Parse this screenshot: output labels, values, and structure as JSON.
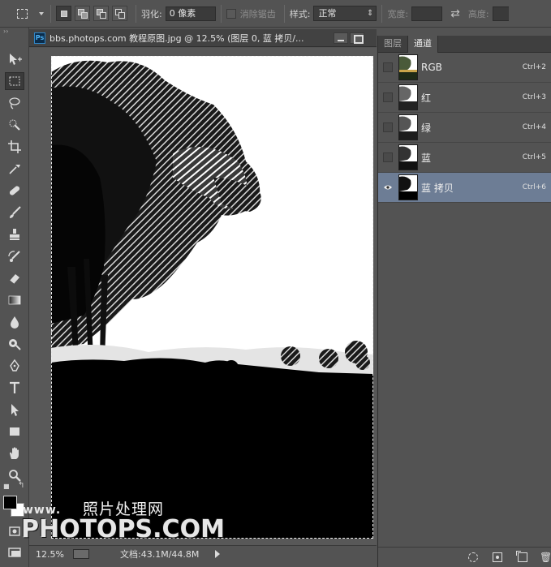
{
  "options_bar": {
    "feather_label": "羽化:",
    "feather_value": "0 像素",
    "antialias_label": "消除锯齿",
    "style_label": "样式:",
    "style_value": "正常",
    "width_label": "宽度:",
    "height_label": "高度:"
  },
  "document": {
    "title": "bbs.photops.com 教程原图.jpg @ 12.5% (图层 0, 蓝 拷贝/...",
    "ps_badge": "Ps",
    "zoom": "12.5%",
    "doc_size": "文档:43.1M/44.8M"
  },
  "watermark": {
    "www": "www.",
    "site_cn": "照片处理网",
    "site": "PHOTOPS.COM"
  },
  "panel": {
    "tabs": [
      {
        "label": "图层",
        "active": false
      },
      {
        "label": "通道",
        "active": true
      }
    ],
    "channels": [
      {
        "name": "RGB",
        "shortcut": "Ctrl+2",
        "visible": false,
        "selected": false
      },
      {
        "name": "红",
        "shortcut": "Ctrl+3",
        "visible": false,
        "selected": false
      },
      {
        "name": "绿",
        "shortcut": "Ctrl+4",
        "visible": false,
        "selected": false
      },
      {
        "name": "蓝",
        "shortcut": "Ctrl+5",
        "visible": false,
        "selected": false
      },
      {
        "name": "蓝 拷贝",
        "shortcut": "Ctrl+6",
        "visible": true,
        "selected": true
      }
    ]
  },
  "colors": {
    "background": "#535353",
    "selected_row": "#6d7d95",
    "foreground_swatch": "#000000",
    "background_swatch": "#ffffff"
  }
}
